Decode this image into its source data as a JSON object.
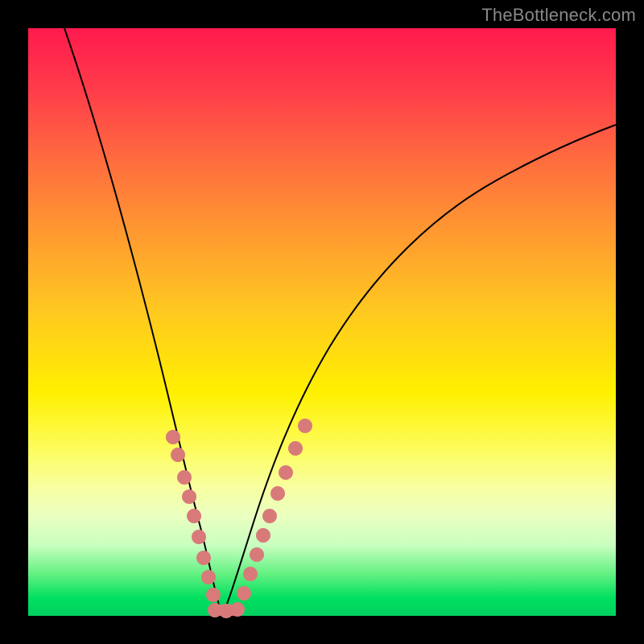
{
  "watermark": "TheBottleneck.com",
  "chart_data": {
    "type": "line",
    "title": "",
    "xlabel": "",
    "ylabel": "",
    "xlim": [
      0,
      100
    ],
    "ylim": [
      0,
      100
    ],
    "series": [
      {
        "name": "left-curve",
        "x": [
          5,
          8,
          11,
          14,
          17,
          20,
          22,
          24,
          26,
          27,
          28,
          29,
          30,
          31,
          32
        ],
        "y": [
          100,
          87,
          74,
          62,
          50,
          40,
          32,
          25,
          18,
          14,
          10,
          6,
          3,
          1,
          0
        ]
      },
      {
        "name": "right-curve",
        "x": [
          32,
          34,
          36,
          38,
          40,
          43,
          47,
          52,
          58,
          65,
          73,
          82,
          91,
          100
        ],
        "y": [
          0,
          2,
          5,
          9,
          14,
          20,
          28,
          36,
          45,
          53,
          61,
          68,
          74,
          79
        ]
      }
    ],
    "markers": {
      "name": "highlighted-points",
      "x": [
        23.5,
        24.5,
        25.5,
        26.5,
        27,
        28,
        29,
        30,
        31,
        32,
        33,
        34,
        35,
        36,
        37,
        38,
        39,
        40,
        41.5,
        43
      ],
      "y": [
        28,
        23,
        19,
        15,
        12,
        8,
        5,
        2.5,
        1,
        0,
        0,
        1,
        2.5,
        5,
        8,
        11,
        14,
        17,
        20,
        23
      ]
    },
    "minimum_x": 32,
    "colors": {
      "curve": "#000000",
      "markers": "#d97a7a"
    }
  }
}
